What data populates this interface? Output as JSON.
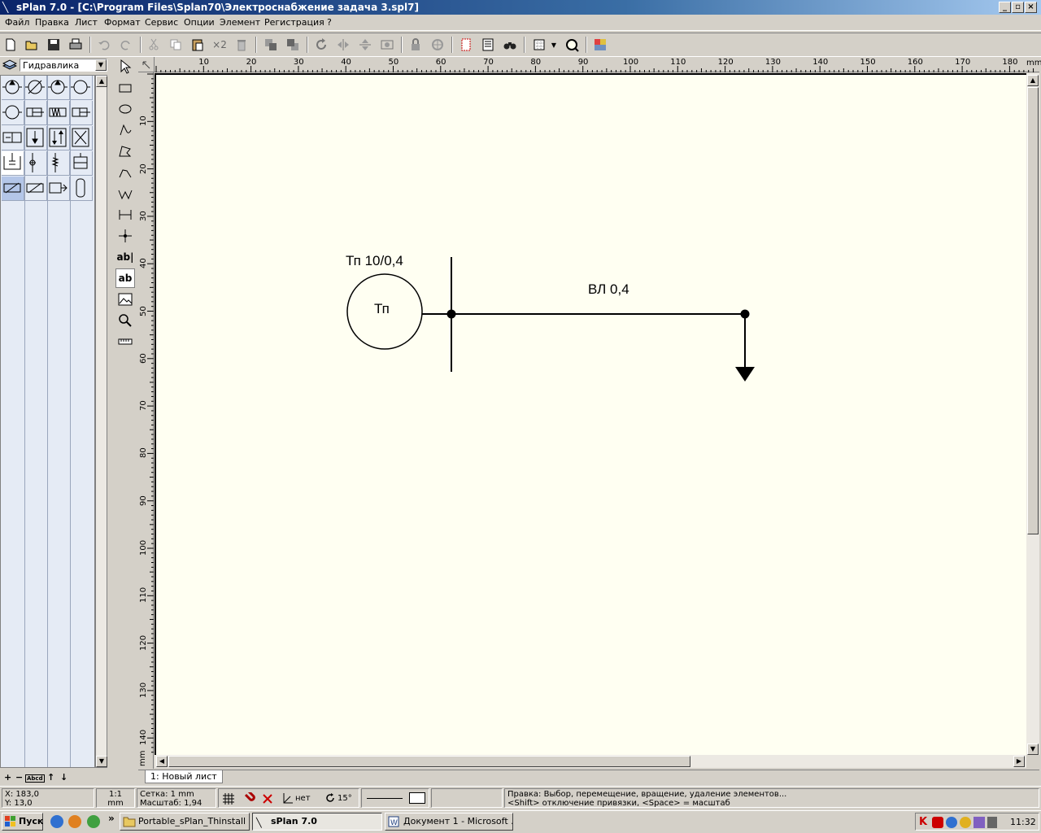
{
  "window": {
    "title": "sPlan 7.0 - [C:\\Program Files\\Splan70\\Электроснабжение задача 3.spl7]",
    "minimize": "_",
    "restore": "▫",
    "close": "×"
  },
  "menu": {
    "items": [
      "Файл",
      "Правка",
      "Лист",
      "Формат",
      "Сервис",
      "Опции",
      "Элемент",
      "Регистрация",
      "?"
    ]
  },
  "toolbar": {
    "icons": [
      "new-file-icon",
      "open-folder-icon",
      "save-icon",
      "print-icon",
      "undo-icon",
      "redo-icon",
      "cut-icon",
      "copy-icon",
      "paste-icon",
      "duplicate-icon",
      "delete-icon",
      "to-front-icon",
      "to-back-icon",
      "rotate-icon",
      "mirror-horizontal-icon",
      "mirror-vertical-icon",
      "group-icon",
      "lock-icon",
      "unlock-icon",
      "page-frame-icon",
      "parts-list-icon",
      "search-binoculars-icon",
      "grid-icon",
      "zoom-fit-icon",
      "color-icon"
    ],
    "duplicate_label": "×2"
  },
  "library": {
    "selected": "Гидравлика",
    "foot_labels": [
      "+",
      "−",
      "Abcd",
      "↑",
      "↓"
    ]
  },
  "ruler": {
    "unit": "mm",
    "h_ticks": [
      "10",
      "20",
      "30",
      "40",
      "50",
      "60",
      "70",
      "80",
      "90",
      "100",
      "110",
      "120",
      "130",
      "140",
      "150",
      "160",
      "170",
      "180"
    ],
    "v_ticks": [
      "10",
      "20",
      "30",
      "40",
      "50",
      "60",
      "70",
      "80",
      "90",
      "100",
      "110",
      "120",
      "130",
      "140"
    ]
  },
  "drawing": {
    "transformer_label": "Тп 10/0,4",
    "transformer_symbol": "Тп",
    "line_label": "ВЛ 0,4"
  },
  "sheet": {
    "tab": "1: Новый лист"
  },
  "status": {
    "x": "X: 183,0",
    "y": "Y: 13,0",
    "scale_ratio": "1:1",
    "scale_unit": "mm",
    "grid": "Сетка: 1 mm",
    "zoom": "Масштаб:   1,94",
    "ortho": "нет",
    "angle": "15°",
    "hint_line1": "Правка: Выбор, перемещение, вращение, удаление элементов...",
    "hint_line2": "<Shift> отключение привязки, <Space> = масштаб"
  },
  "taskbar": {
    "start": "Пуск",
    "tasks": [
      "Portable_sPlan_Thinstall",
      "sPlan 7.0",
      "Документ 1 - Microsoft ..."
    ],
    "clock": "11:32"
  }
}
